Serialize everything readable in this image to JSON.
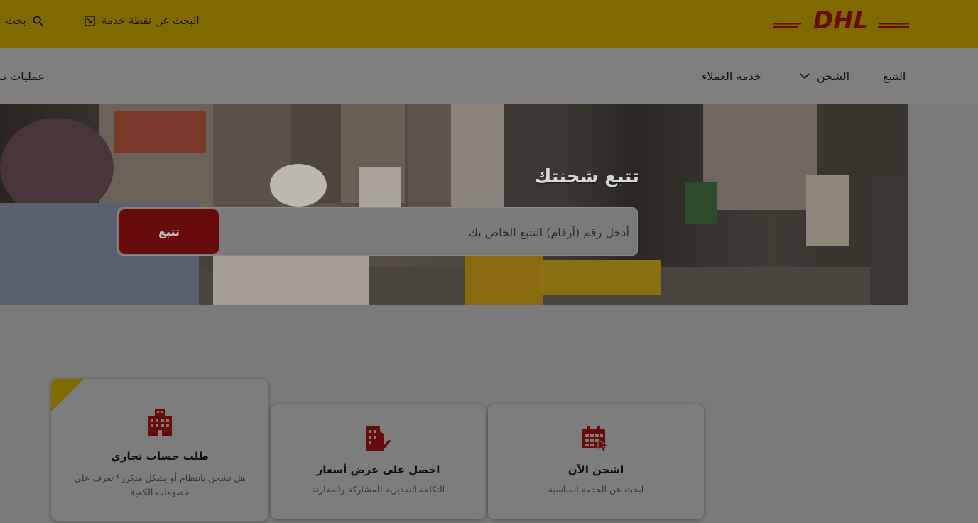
{
  "brand": {
    "logo_text": "DHL",
    "color_yellow": "#806a00",
    "color_red": "#680b0b"
  },
  "topbar": {
    "service_point_label": "البحث عن نقطة خدمة",
    "service_point_icon": "external-link-icon",
    "search_label": "بحث",
    "search_icon": "search-icon"
  },
  "nav": {
    "items": [
      {
        "label": "التتبع"
      },
      {
        "label": "الشحن",
        "has_dropdown": true
      },
      {
        "label": "خدمة العملاء"
      },
      {
        "label": "عمليات تـ"
      }
    ]
  },
  "hero": {
    "title": "تتبع شحنتك",
    "input_placeholder": "أدخل رقم (أرقام) التتبع الخاص بك",
    "button_label": "تتبع"
  },
  "cards": [
    {
      "title": "طلب حساب تجاري",
      "desc": "هل تشحن بانتظام أو بشكل متكرر؟ تعرف على خصومات الكمية",
      "icon": "building-icon"
    },
    {
      "title": "احصل على عرض أسعار",
      "desc": "التكلفة التقديرية للمشاركة والمقارنة",
      "icon": "document-check-icon"
    },
    {
      "title": "اشحن الآن",
      "desc": "ابحث عن الخدمة المناسبة",
      "icon": "calendar-cursor-icon"
    }
  ]
}
